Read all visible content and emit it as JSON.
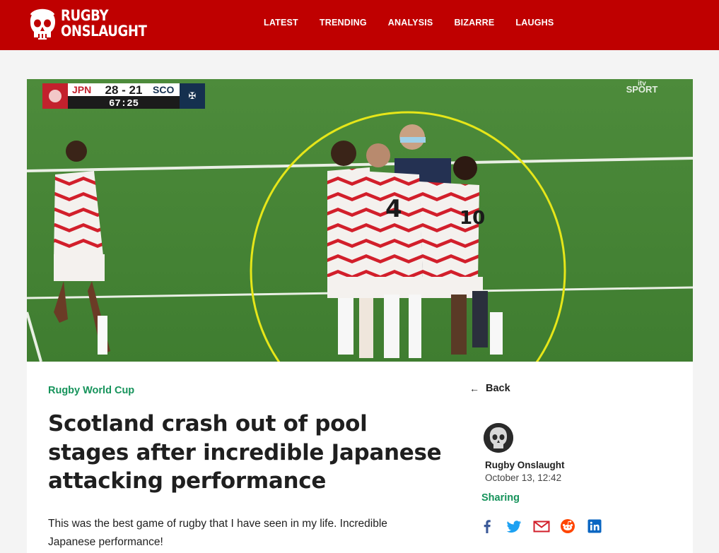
{
  "header": {
    "logo_line1": "RUGBY",
    "logo_line2": "ONSLAUGHT",
    "nav": [
      "LATEST",
      "TRENDING",
      "ANALYSIS",
      "BIZARRE",
      "LAUGHS"
    ]
  },
  "hero": {
    "scorebug": {
      "home": "JPN",
      "away": "SCO",
      "score": "28 - 21",
      "clock": "67:25"
    },
    "broadcaster_top": "itv",
    "broadcaster": "SPORT",
    "jersey_numbers": [
      "4",
      "10"
    ]
  },
  "article": {
    "category": "Rugby World Cup",
    "headline": "Scotland crash out of pool stages after incredible Japanese attacking performance",
    "lead": "This was the best game of rugby that I have seen in my life.  Incredible Japanese performance!"
  },
  "sidebar": {
    "back_icon": "←",
    "back_label": "Back",
    "author": "Rugby Onslaught",
    "date": "October 13, 12:42",
    "sharing_label": "Sharing",
    "share_icons": [
      "facebook-icon",
      "twitter-icon",
      "email-icon",
      "reddit-icon",
      "linkedin-icon"
    ]
  },
  "colors": {
    "brand_red": "#bf0000",
    "accent_green": "#16935b",
    "pitch_green": "#4a8a3a",
    "highlight_yellow": "#e6e619"
  }
}
